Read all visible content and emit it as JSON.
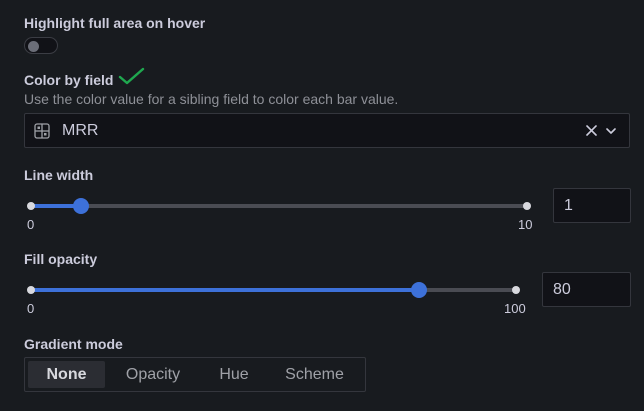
{
  "highlight": {
    "label": "Highlight full area on hover",
    "enabled": false
  },
  "color_by_field": {
    "label": "Color by field",
    "description": "Use the color value for a sibling field to color each bar value.",
    "selected": "MRR",
    "icons": {
      "status": "checkmark-icon",
      "field": "field-grid-icon",
      "clear": "close-icon",
      "open": "chevron-down-icon"
    },
    "colors": {
      "check": "#1fa84f"
    }
  },
  "line_width": {
    "label": "Line width",
    "min_label": "0",
    "max_label": "10",
    "min": 0,
    "max": 10,
    "value": 1,
    "value_text": "1"
  },
  "fill_opacity": {
    "label": "Fill opacity",
    "min_label": "0",
    "max_label": "100",
    "min": 0,
    "max": 100,
    "value": 80,
    "value_text": "80"
  },
  "gradient_mode": {
    "label": "Gradient mode",
    "options": [
      {
        "label": "None",
        "active": true
      },
      {
        "label": "Opacity",
        "active": false
      },
      {
        "label": "Hue",
        "active": false
      },
      {
        "label": "Scheme",
        "active": false
      }
    ]
  },
  "colors": {
    "background": "#181b1f",
    "accent": "#3d71d9",
    "input_bg": "#111217",
    "border": "#34363d"
  }
}
